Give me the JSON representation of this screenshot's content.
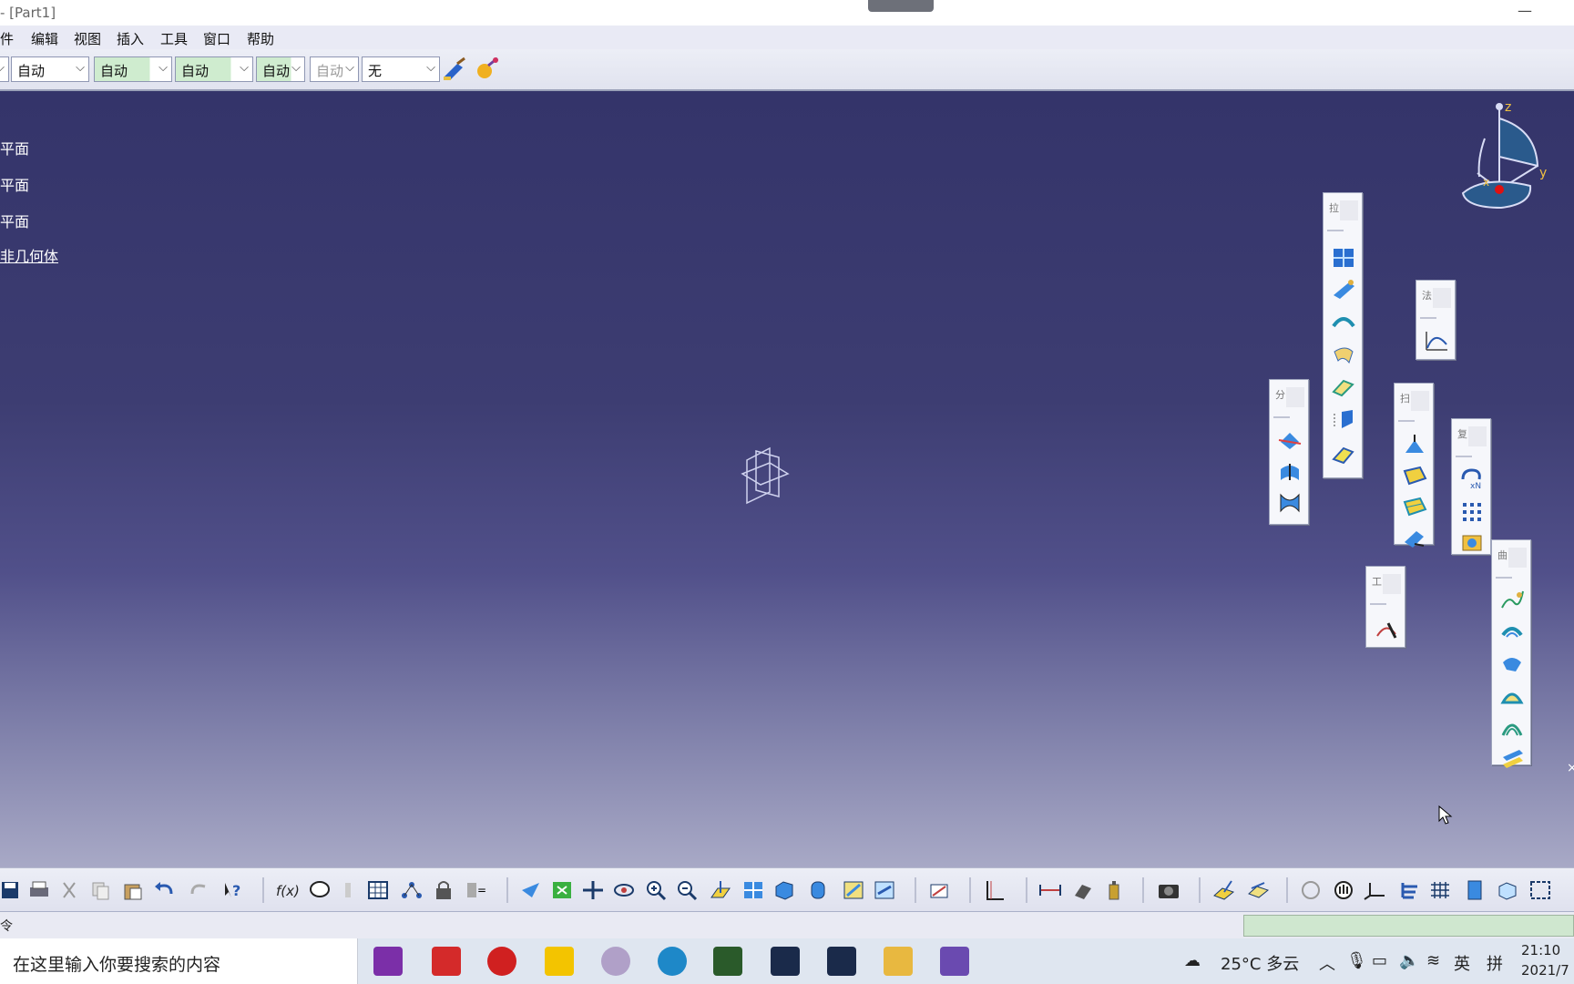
{
  "window": {
    "title": "- [Part1]"
  },
  "menu": {
    "items": [
      "件",
      "编辑",
      "视图",
      "插入",
      "工具",
      "窗口",
      "帮助"
    ]
  },
  "toolbar": {
    "combo1": "自动",
    "combo2": "自动",
    "combo3": "自动",
    "combo4": "自动",
    "combo5": "自动",
    "combo6": "无"
  },
  "tree": {
    "items": [
      "平面",
      "平面",
      "平面",
      "非几何体"
    ]
  },
  "compass": {
    "z": "z",
    "y": "y",
    "x": "x"
  },
  "palettes": {
    "p1": "拉",
    "p2": "分",
    "p3": "法",
    "p4": "扫",
    "p5": "复",
    "p6": "工",
    "p7": "曲"
  },
  "statusbar": {
    "command_prefix": "令"
  },
  "taskbar": {
    "search_placeholder": "在这里输入你要搜索的内容",
    "weather": "25°C 多云",
    "input_lang": "英",
    "ime": "拼",
    "time": "21:10",
    "date": "2021/7"
  },
  "colors": {
    "viewport_top": "#34346a",
    "viewport_bottom": "#a8a9c6",
    "status_prompt": "#cfe7cf"
  }
}
